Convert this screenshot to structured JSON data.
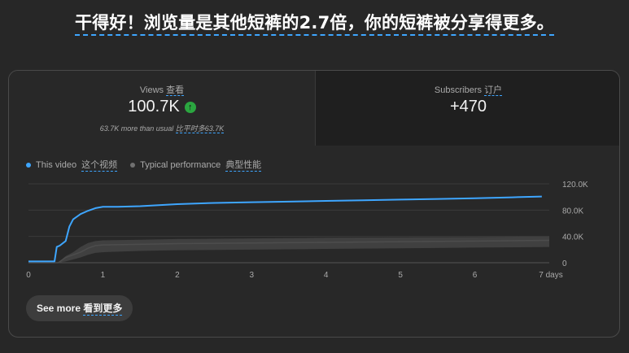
{
  "headline": "干得好！浏览量是其他短裤的2.7倍，你的短裤被分享得更多。",
  "views": {
    "label": "Views",
    "label_cn": "查看",
    "value": "100.7K",
    "comparison": "63.7K more than usual",
    "comparison_cn": "比平时多63.7K"
  },
  "subscribers": {
    "label": "Subscribers",
    "label_cn": "订户",
    "value": "+470"
  },
  "legend": {
    "this_video": "This video",
    "this_video_cn": "这个视频",
    "typical": "Typical performance",
    "typical_cn": "典型性能"
  },
  "see_more": {
    "label": "See more",
    "label_cn": "看到更多"
  },
  "colors": {
    "this_video": "#3ea6ff",
    "typical_band": "#404040",
    "typical_line": "#4d4d4d",
    "up_badge": "#2ba640",
    "accent": "#3ea6ff"
  },
  "chart_data": {
    "type": "line",
    "x_tick_labels": [
      "0",
      "1",
      "2",
      "3",
      "4",
      "5",
      "6",
      "7 days"
    ],
    "x_ticks": [
      0,
      1,
      2,
      3,
      4,
      5,
      6,
      7
    ],
    "y_tick_labels": [
      "120.0K",
      "80.0K",
      "40.0K",
      "0"
    ],
    "y_ticks": [
      120000,
      80000,
      40000,
      0
    ],
    "xlim": [
      0,
      7
    ],
    "ylim": [
      0,
      120000
    ],
    "grid": true,
    "legend_position": "top-left",
    "series": [
      {
        "name": "This video",
        "x": [
          0,
          0.3,
          0.35,
          0.38,
          0.42,
          0.5,
          0.55,
          0.6,
          0.7,
          0.8,
          0.9,
          1.0,
          1.2,
          1.5,
          2.0,
          2.5,
          3.0,
          3.5,
          4.0,
          4.5,
          5.0,
          5.5,
          6.0,
          6.5,
          6.9
        ],
        "y": [
          2000,
          2000,
          2000,
          24000,
          26000,
          33000,
          55000,
          66000,
          74000,
          79000,
          83000,
          85000,
          85000,
          86000,
          89000,
          91000,
          92000,
          93000,
          94000,
          95000,
          96000,
          97000,
          98000,
          99500,
          100700
        ]
      },
      {
        "name": "Typical performance",
        "x": [
          0,
          0.4,
          0.5,
          0.6,
          0.7,
          0.8,
          0.9,
          1.0,
          1.5,
          2.0,
          3.0,
          4.0,
          5.0,
          6.0,
          7.0
        ],
        "y": [
          0,
          0,
          8000,
          12000,
          16000,
          22000,
          26000,
          27000,
          28000,
          29000,
          30000,
          31000,
          32000,
          33000,
          34000
        ],
        "band_high": [
          0,
          0,
          10000,
          16000,
          24000,
          30000,
          33000,
          34000,
          35000,
          36000,
          37000,
          38000,
          38500,
          39000,
          40000
        ],
        "band_low": [
          0,
          0,
          2000,
          5000,
          8000,
          12000,
          15000,
          16000,
          18000,
          19000,
          20000,
          21000,
          22000,
          23000,
          24000
        ]
      }
    ]
  }
}
